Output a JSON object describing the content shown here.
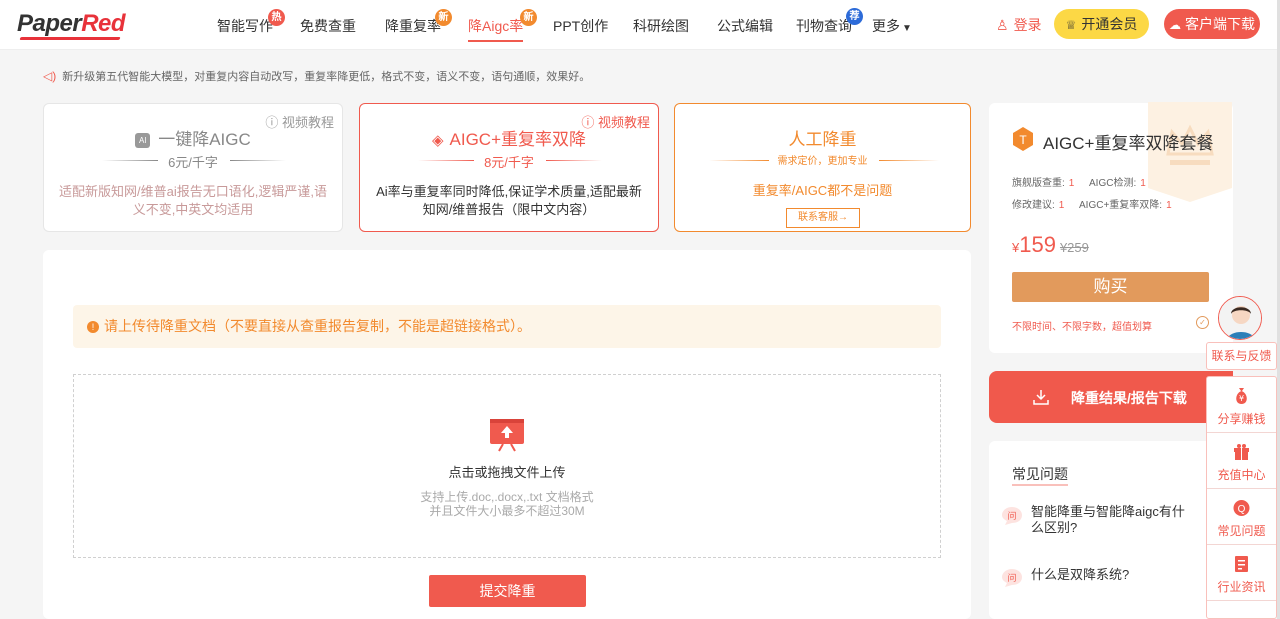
{
  "header": {
    "logo_a": "Paper",
    "logo_b": "Red",
    "nav": [
      {
        "label": "智能写作",
        "badge": "热"
      },
      {
        "label": "免费查重"
      },
      {
        "label": "降重复率",
        "badge": "新"
      },
      {
        "label": "降Aigc率",
        "badge": "新"
      },
      {
        "label": "PPT创作"
      },
      {
        "label": "科研绘图"
      },
      {
        "label": "公式编辑"
      },
      {
        "label": "刊物查询",
        "badge": "荐"
      },
      {
        "label": "更多"
      }
    ],
    "login": "登录",
    "vip": "开通会员",
    "download": "客户端下载"
  },
  "notice": "新升级第五代智能大模型，对重复内容自动改写，重复率降更低，格式不变，语义不变，语句通顺，效果好。",
  "cards": [
    {
      "video": "视频教程",
      "title": "一键降AIGC",
      "price": "6元/千字",
      "desc": "适配新版知网/维普ai报告无口语化,逻辑严谨,语义不变,中英文均适用"
    },
    {
      "video": "视频教程",
      "title": "AIGC+重复率双降",
      "price": "8元/千字",
      "desc": "Ai率与重复率同时降低,保证学术质量,适配最新知网/维普报告（限中文内容）"
    },
    {
      "title": "人工降重",
      "price": "需求定价，更加专业",
      "desc": "重复率/AIGC都不是问题",
      "button": "联系客服→"
    }
  ],
  "upload": {
    "warning": "请上传待降重文档（不要直接从查重报告复制，不能是超链接格式）。",
    "main": "点击或拖拽文件上传",
    "sub1": "支持上传.doc,.docx,.txt 文档格式",
    "sub2": "并且文件大小最多不超过30M",
    "submit": "提交降重"
  },
  "package": {
    "title": "AIGC+重复率双降套餐",
    "rows": [
      {
        "label": "旗舰版查重:",
        "value": "1"
      },
      {
        "label": "AIGC检测:",
        "value": "1"
      },
      {
        "label": "修改建议:",
        "value": "1"
      },
      {
        "label": "AIGC+重复率双降:",
        "value": "1"
      }
    ],
    "currency": "¥",
    "price": "159",
    "old_price": "¥259",
    "buy": "购买",
    "note": "不限时间、不限字数，超值划算"
  },
  "result_button": "降重结果/报告下载",
  "faq": {
    "title": "常见问题",
    "items": [
      "智能降重与智能降aigc有什么区别?",
      "什么是双降系统?"
    ]
  },
  "side": {
    "feedback": "联系与反馈",
    "items": [
      "分享赚钱",
      "充值中心",
      "常见问题",
      "行业资讯"
    ]
  },
  "colors": {
    "accent": "#f05a4e",
    "orange": "#f28a2e",
    "yellow": "#fcd845"
  }
}
